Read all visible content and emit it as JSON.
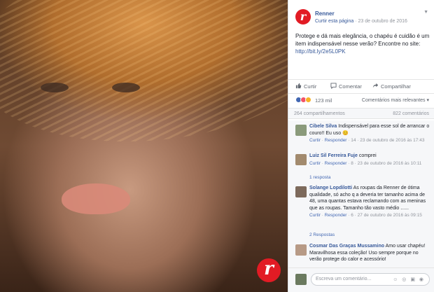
{
  "page": {
    "name": "Renner",
    "liked": "Curtir esta página",
    "date": "23 de outubro de 2016",
    "logo_letter": "r"
  },
  "post": {
    "text": "Protege e dá mais elegância, o chapéu é cuidão é um item indispensável nesse verão? Encontre no site: ",
    "url": "http://bit.ly/2e5L0PK"
  },
  "actions": {
    "like": "Curtir",
    "comment": "Comentar",
    "share": "Compartilhar"
  },
  "reactions": {
    "count": "123 mil",
    "order": "Comentários mais relevantes ▾",
    "colors": {
      "like": "#4267b2",
      "love": "#f25268",
      "haha": "#f7b125"
    }
  },
  "stats": {
    "shares": "264 compartilhamentos",
    "comments": "822 comentários"
  },
  "comments": [
    {
      "name": "Cibele Silva",
      "text": "Indispensável para esse sol de arrancar o couro!! Eu uso 😊",
      "like": "Curtir",
      "reply": "Responder",
      "meta": "14 · 23 de outubro de 2016 às 17:43"
    },
    {
      "name": "Luiz Sil Ferreira Fuje",
      "text": "comprei",
      "like": "Curtir",
      "reply": "Responder",
      "meta": "8 · 23 de outubro de 2016 às 10:11",
      "replies": "1 resposta"
    },
    {
      "name": "Solange Lopdilotti",
      "text": "As roupas da Renner de ótima qualidade, só acho q a deveria ter tamanho acima de 48, uma quantas estava reclamando com as meninas que as roupas. Tamanho tão vasto médio ......",
      "like": "Curtir",
      "reply": "Responder",
      "meta": "6 · 27 de outubro de 2016 às 09:15",
      "replies": "2 Respostas"
    },
    {
      "name": "Cosmar Das Graças Mussamino",
      "text": "Amo usar chapéu! Maravilhosa essa coleção! Uso sempre porque no verão protege do calor e acessório!",
      "like": "",
      "reply": "",
      "meta": ""
    }
  ],
  "composer": {
    "placeholder": "Escreva um comentário...",
    "icons": "☺ ◎ ▣ ◉"
  }
}
